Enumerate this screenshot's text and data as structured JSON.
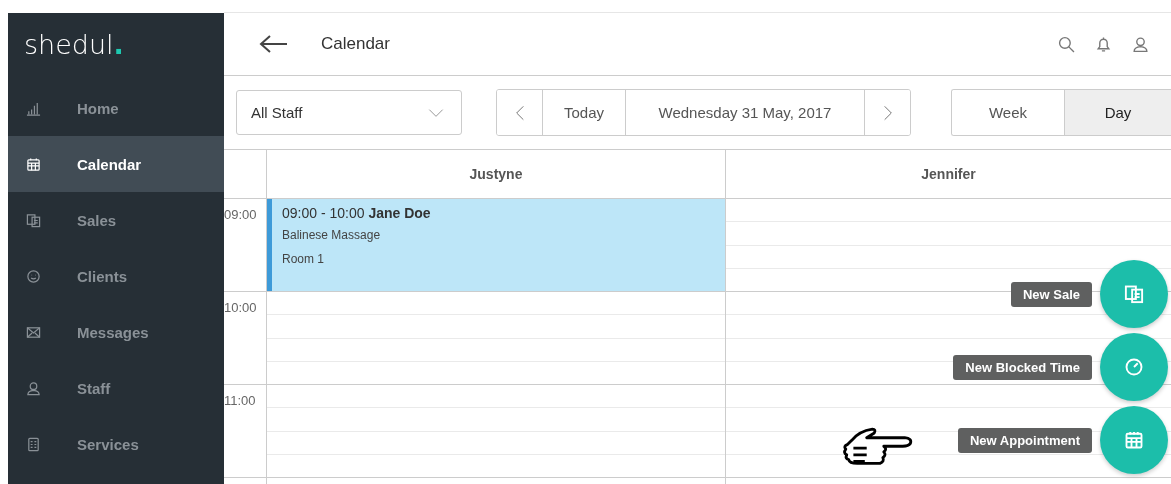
{
  "sidebar": {
    "logo": {
      "name": "shedul",
      "mark": "."
    },
    "items": [
      {
        "label": "Home",
        "selected": false
      },
      {
        "label": "Calendar",
        "selected": true
      },
      {
        "label": "Sales",
        "selected": false
      },
      {
        "label": "Clients",
        "selected": false
      },
      {
        "label": "Messages",
        "selected": false
      },
      {
        "label": "Staff",
        "selected": false
      },
      {
        "label": "Services",
        "selected": false
      }
    ]
  },
  "header": {
    "title": "Calendar"
  },
  "toolbar": {
    "staff_select": {
      "value": "All Staff"
    },
    "today": "Today",
    "date": "Wednesday 31 May, 2017",
    "views": [
      {
        "label": "Week",
        "selected": false
      },
      {
        "label": "Day",
        "selected": true
      }
    ]
  },
  "calendar": {
    "columns": [
      "Justyne",
      "Jennifer"
    ],
    "hours": [
      "09:00",
      "10:00",
      "11:00"
    ],
    "appointments": [
      {
        "time": "09:00 - 10:00",
        "client": "Jane Doe",
        "service": "Balinese Massage",
        "room": "Room 1"
      }
    ]
  },
  "actions": [
    {
      "label": "New Sale"
    },
    {
      "label": "New Blocked Time"
    },
    {
      "label": "New Appointment"
    }
  ]
}
